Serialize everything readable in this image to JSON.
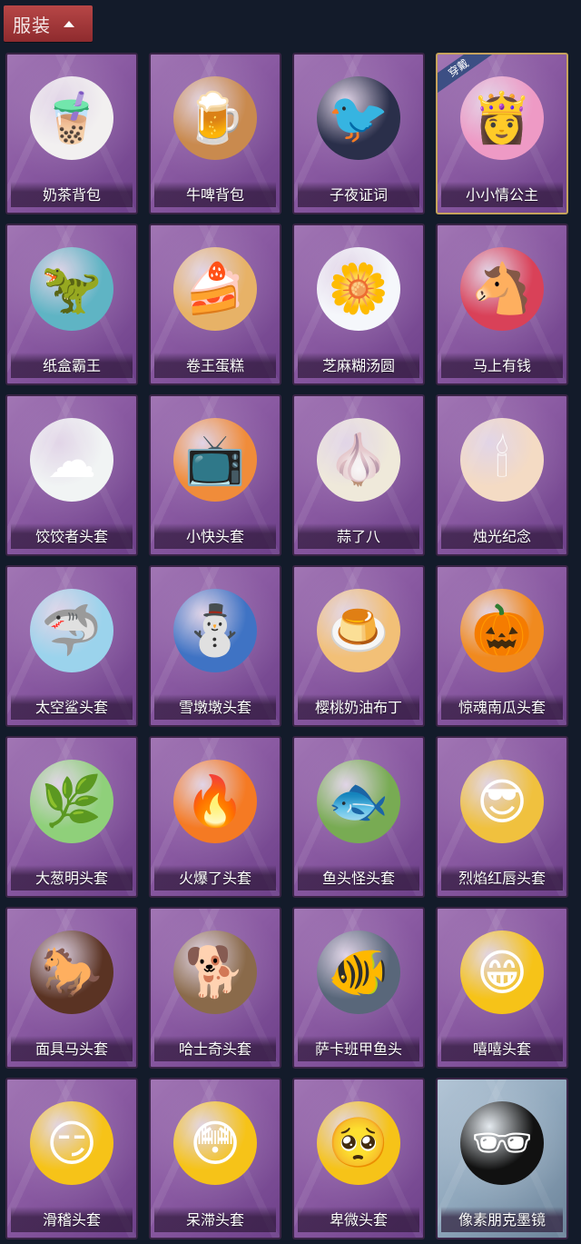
{
  "header": {
    "title": "服装"
  },
  "items": [
    {
      "label": "奶茶背包",
      "icon": "milk-tea-backpack-icon",
      "color": "#f2f0f0",
      "glyph": "🧋"
    },
    {
      "label": "牛啤背包",
      "icon": "cow-beer-backpack-icon",
      "color": "#c98a4e",
      "glyph": "🍺"
    },
    {
      "label": "子夜证词",
      "icon": "crow-doctor-icon",
      "color": "#2a2f4a",
      "glyph": "🐦"
    },
    {
      "label": "小小情公主",
      "icon": "princess-icon",
      "color": "#ee9ac5",
      "glyph": "👸",
      "selected": true,
      "badge": "穿戴"
    },
    {
      "label": "纸盒霸王",
      "icon": "box-dinosaur-icon",
      "color": "#5fb4c4",
      "glyph": "🦖"
    },
    {
      "label": "卷王蛋糕",
      "icon": "roll-cake-icon",
      "color": "#e7b267",
      "glyph": "🍰"
    },
    {
      "label": "芝麻糊汤圆",
      "icon": "dumpling-ball-icon",
      "color": "#f5f7fb",
      "glyph": "🌼"
    },
    {
      "label": "马上有钱",
      "icon": "red-horse-icon",
      "color": "#d94158",
      "glyph": "🐴"
    },
    {
      "label": "饺饺者头套",
      "icon": "cloud-dumpling-icon",
      "color": "#f1f4f4",
      "glyph": "☁"
    },
    {
      "label": "小快头套",
      "icon": "tv-head-icon",
      "color": "#f08c3a",
      "glyph": "📺"
    },
    {
      "label": "蒜了八",
      "icon": "garlic-icon",
      "color": "#efe9da",
      "glyph": "🧄"
    },
    {
      "label": "烛光纪念",
      "icon": "candle-icon",
      "color": "#f4dbc4",
      "glyph": "🕯"
    },
    {
      "label": "太空鲨头套",
      "icon": "shark-icon",
      "color": "#9bd3ec",
      "glyph": "🦈"
    },
    {
      "label": "雪墩墩头套",
      "icon": "snowman-icon",
      "color": "#3f73c4",
      "glyph": "⛄"
    },
    {
      "label": "樱桃奶油布丁",
      "icon": "pudding-icon",
      "color": "#f2c077",
      "glyph": "🍮"
    },
    {
      "label": "惊魂南瓜头套",
      "icon": "pumpkin-icon",
      "color": "#f08a1f",
      "glyph": "🎃"
    },
    {
      "label": "大葱明头套",
      "icon": "green-onion-icon",
      "color": "#8fd07a",
      "glyph": "🌿"
    },
    {
      "label": "火爆了头套",
      "icon": "fire-icon",
      "color": "#f57a23",
      "glyph": "🔥"
    },
    {
      "label": "鱼头怪头套",
      "icon": "fish-mask-icon",
      "color": "#78ab53",
      "glyph": "🐟"
    },
    {
      "label": "烈焰红唇头套",
      "icon": "pikachu-mask-icon",
      "color": "#f0c13e",
      "glyph": "😎"
    },
    {
      "label": "面具马头套",
      "icon": "horse-mask-icon",
      "color": "#5a3323",
      "glyph": "🐎"
    },
    {
      "label": "哈士奇头套",
      "icon": "husky-icon",
      "color": "#8a6a4a",
      "glyph": "🐕"
    },
    {
      "label": "萨卡班甲鱼头",
      "icon": "armored-fish-icon",
      "color": "#59677a",
      "glyph": "🐠"
    },
    {
      "label": "嘻嘻头套",
      "icon": "grin-emoji-icon",
      "color": "#f6c318",
      "glyph": "😁"
    },
    {
      "label": "滑稽头套",
      "icon": "funny-emoji-icon",
      "color": "#f6c318",
      "glyph": "😏"
    },
    {
      "label": "呆滞头套",
      "icon": "blank-emoji-icon",
      "color": "#f6c318",
      "glyph": "😳"
    },
    {
      "label": "卑微头套",
      "icon": "humble-emoji-icon",
      "color": "#f6c318",
      "glyph": "🥺"
    },
    {
      "label": "像素朋克墨镜",
      "icon": "pixel-sunglasses-icon",
      "color": "#111111",
      "glyph": "🕶",
      "grey": true
    }
  ]
}
